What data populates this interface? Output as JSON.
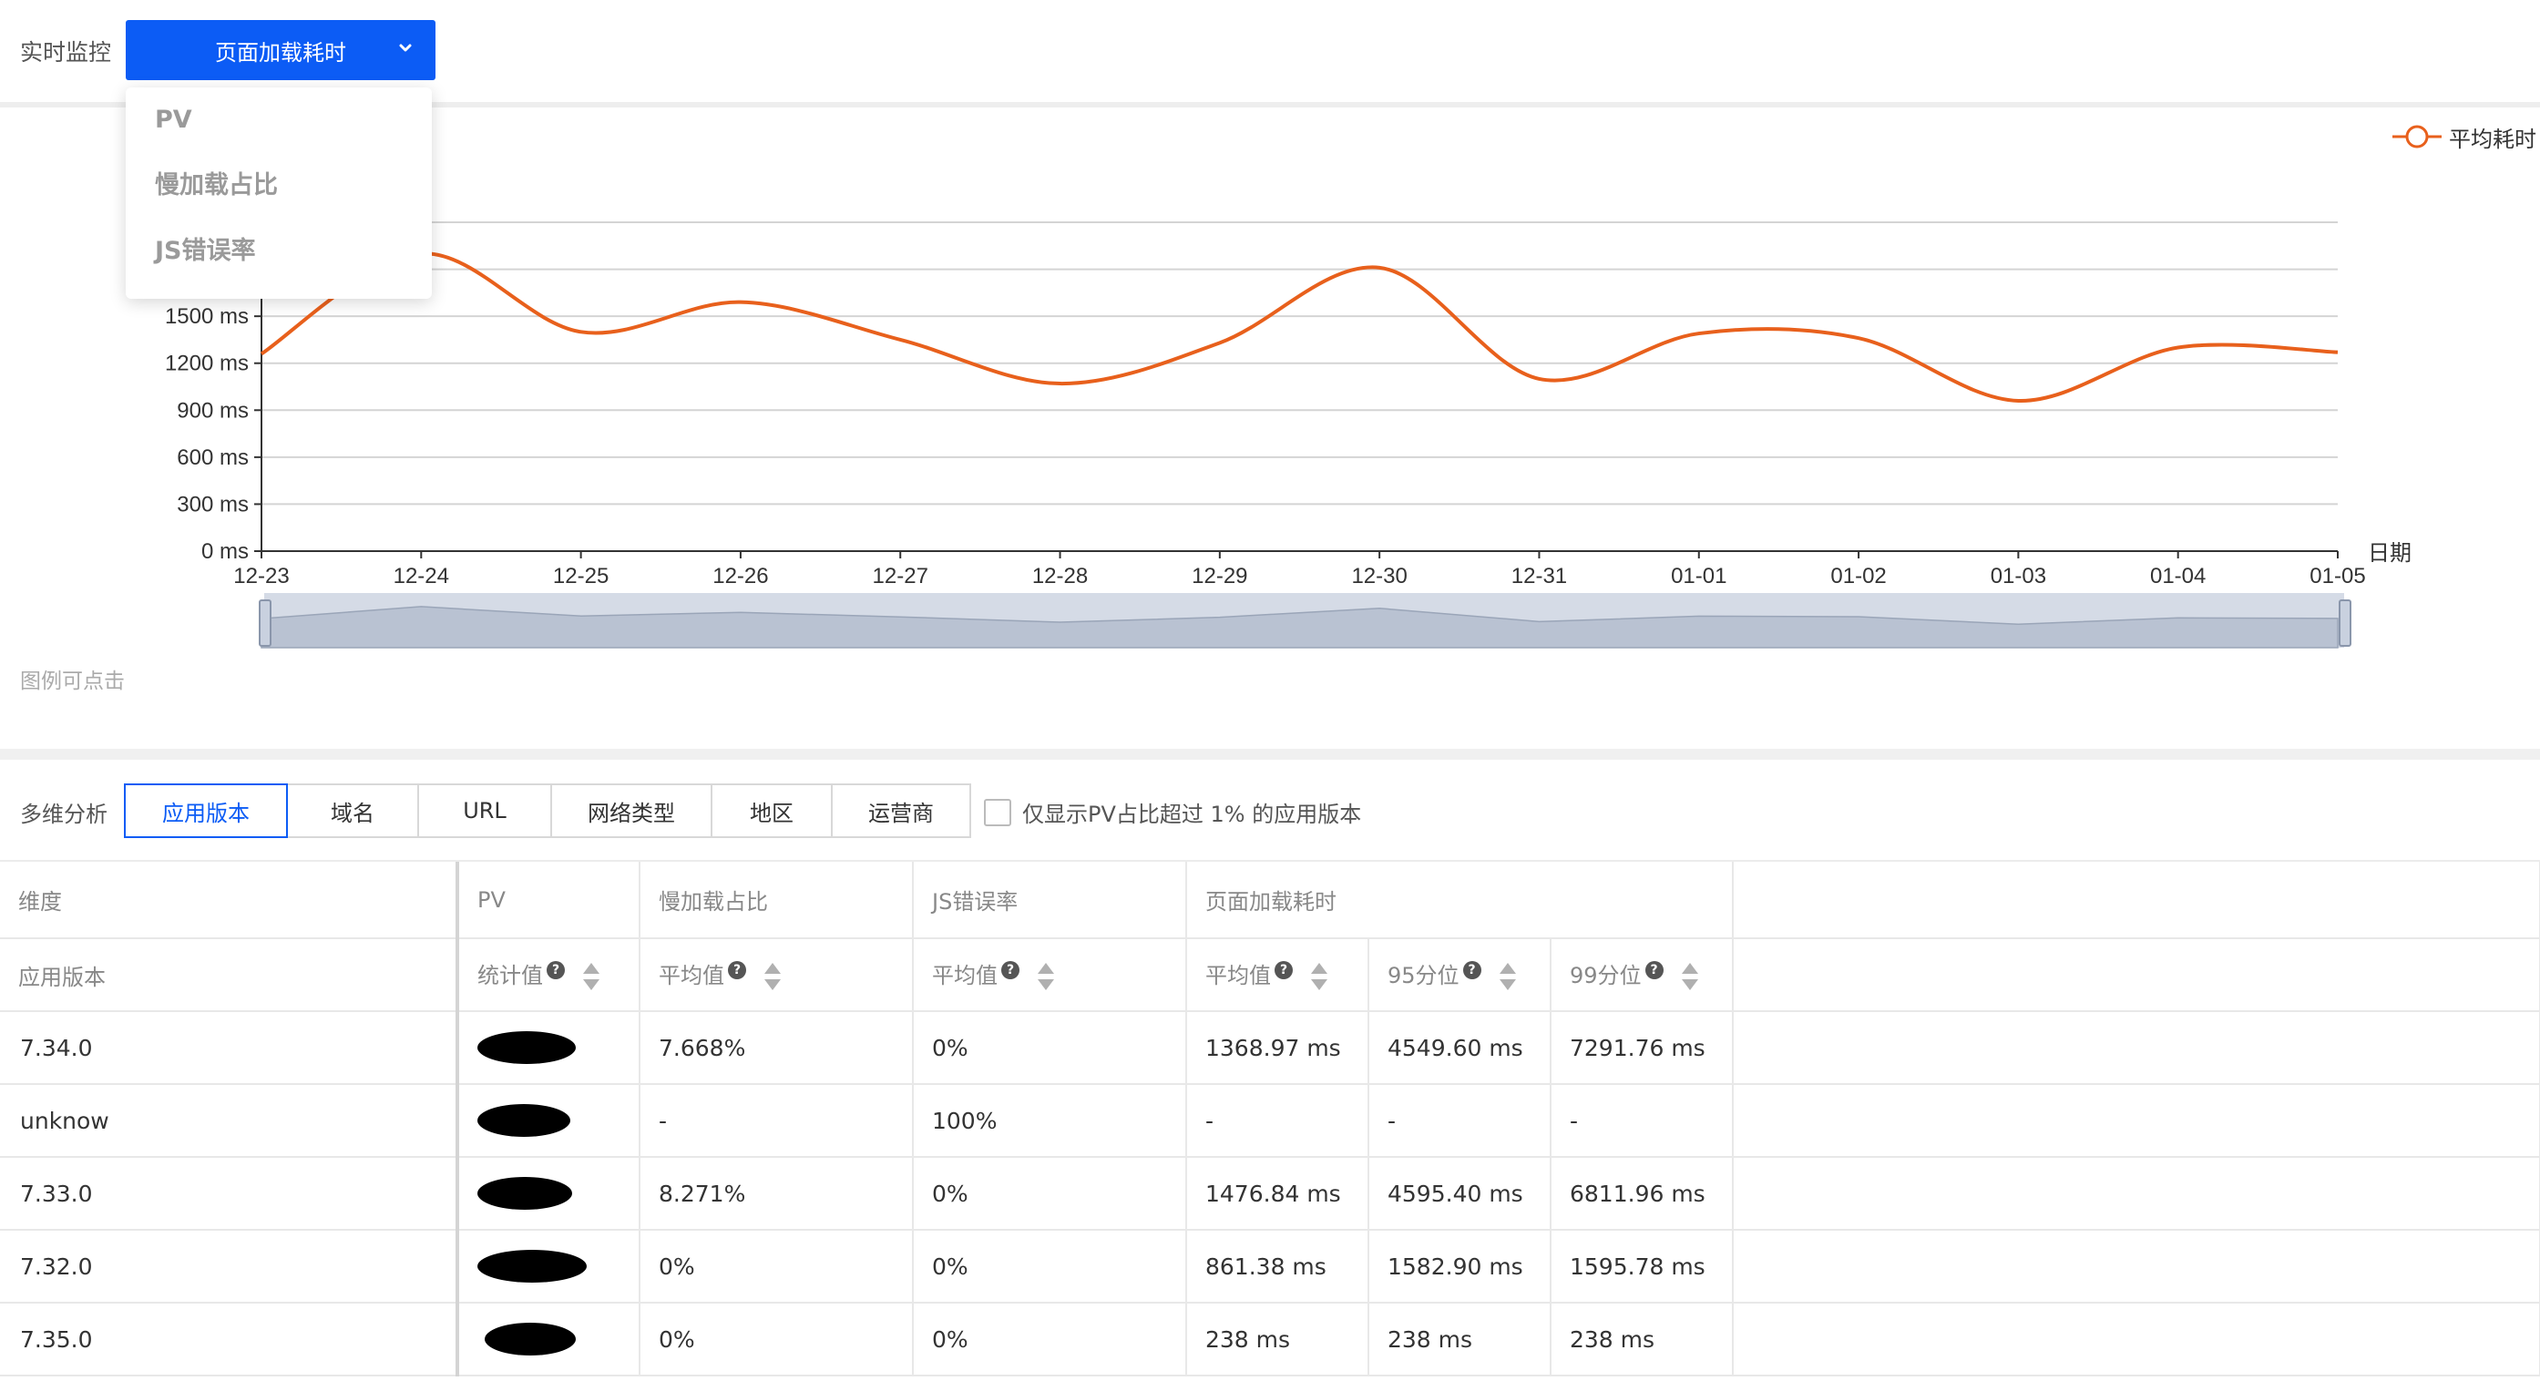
{
  "topbar": {
    "label": "实时监控",
    "selected_metric": "页面加载耗时",
    "dropdown_items": [
      "PV",
      "慢加载占比",
      "JS错误率"
    ]
  },
  "chart": {
    "legend": "平均耗时",
    "hint": "图例可点击",
    "series_color": "#e8601c"
  },
  "chart_data": {
    "type": "line",
    "x": [
      "12-23",
      "12-24",
      "12-25",
      "12-26",
      "12-27",
      "12-28",
      "12-29",
      "12-30",
      "12-31",
      "01-01",
      "01-02",
      "01-03",
      "01-04",
      "01-05"
    ],
    "series": [
      {
        "name": "平均耗时",
        "values": [
          1260,
          1900,
          1400,
          1590,
          1350,
          1070,
          1330,
          1810,
          1100,
          1390,
          1360,
          960,
          1300,
          1270
        ]
      }
    ],
    "yticks": [
      "0 ms",
      "300 ms",
      "600 ms",
      "900 ms",
      "1200 ms",
      "1500 ms"
    ],
    "ylim": [
      0,
      2100
    ],
    "xlabel": "日期",
    "grid": true,
    "legend_position": "top-right",
    "smooth": true
  },
  "multi": {
    "label": "多维分析",
    "tabs": [
      "应用版本",
      "域名",
      "URL",
      "网络类型",
      "地区",
      "运营商"
    ],
    "active_tab": "应用版本",
    "filter_label": "仅显示PV占比超过 1% 的应用版本"
  },
  "table": {
    "groups": [
      "维度",
      "PV",
      "慢加载占比",
      "JS错误率",
      "页面加载耗时"
    ],
    "subheaders": [
      "应用版本",
      "统计值",
      "平均值",
      "平均值",
      "平均值",
      "95分位",
      "99分位"
    ],
    "rows": [
      {
        "dim": "7.34.0",
        "slow": "7.668%",
        "js": "0%",
        "avg": "1368.97 ms",
        "p95": "4549.60 ms",
        "p99": "7291.76 ms"
      },
      {
        "dim": "unknow",
        "slow": "-",
        "js": "100%",
        "avg": "-",
        "p95": "-",
        "p99": "-"
      },
      {
        "dim": "7.33.0",
        "slow": "8.271%",
        "js": "0%",
        "avg": "1476.84 ms",
        "p95": "4595.40 ms",
        "p99": "6811.96 ms"
      },
      {
        "dim": "7.32.0",
        "slow": "0%",
        "js": "0%",
        "avg": "861.38 ms",
        "p95": "1582.90 ms",
        "p99": "1595.78 ms"
      },
      {
        "dim": "7.35.0",
        "slow": "0%",
        "js": "0%",
        "avg": "238 ms",
        "p95": "238 ms",
        "p99": "238 ms"
      }
    ]
  }
}
